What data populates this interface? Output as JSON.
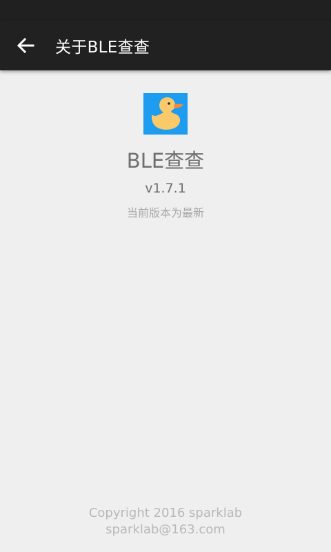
{
  "app_bar": {
    "title": "关于BLE查查",
    "back_icon": "arrow-left-icon"
  },
  "about": {
    "icon": "duck-icon",
    "icon_bg_color": "#1e9cf0",
    "app_name": "BLE查查",
    "version": "v1.7.1",
    "update_status": "当前版本为最新"
  },
  "footer": {
    "copyright": "Copyright 2016 sparklab",
    "email": "sparklab@163.com"
  },
  "colors": {
    "app_bar": "#212121",
    "background": "#efefef"
  }
}
